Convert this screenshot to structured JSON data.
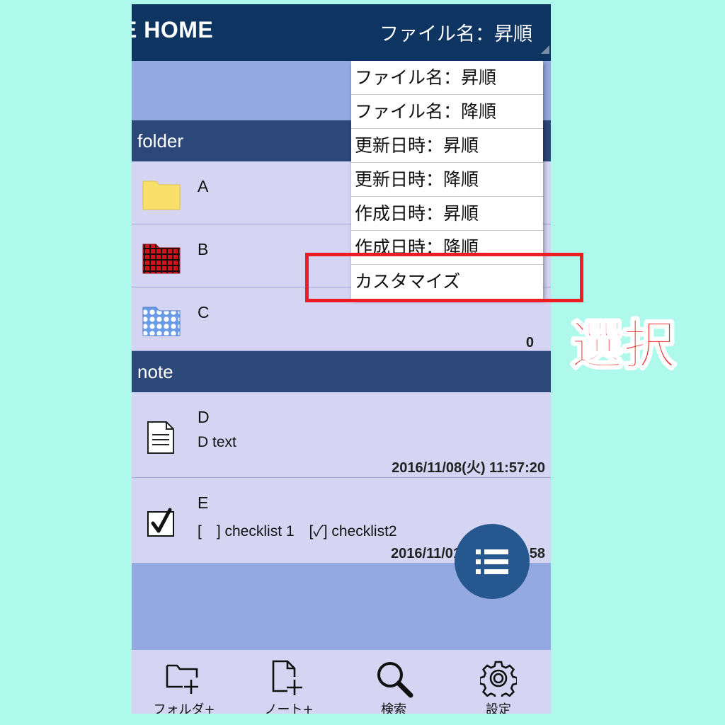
{
  "header": {
    "title": "E HOME",
    "sort_label": "ファイル名：昇順"
  },
  "folder_section": {
    "label": "folder",
    "items": [
      {
        "name": "A",
        "icon": "yellow-folder-icon"
      },
      {
        "name": "B",
        "icon": "red-plaid-folder-icon"
      },
      {
        "name": "C",
        "icon": "blue-polka-dot-folder-icon",
        "count": "0"
      }
    ]
  },
  "note_section": {
    "label": "note",
    "items": [
      {
        "name": "D",
        "preview": "D text",
        "date": "2016/11/08(火) 11:57:20",
        "icon": "document-icon"
      },
      {
        "name": "E",
        "preview": "[　] checklist 1　[✓] checklist2",
        "date": "2016/11/01(火) 10:39:58",
        "icon": "checkbox-icon"
      }
    ]
  },
  "sort_menu": {
    "items": [
      "ファイル名：昇順",
      "ファイル名：降順",
      "更新日時：昇順",
      "更新日時：降順",
      "作成日時：昇順",
      "作成日時：降順",
      "カスタマイズ"
    ]
  },
  "annotation": {
    "label": "選択",
    "color": "#ee1d23"
  },
  "bottom_nav": {
    "items": [
      {
        "label": "フォルダ+",
        "icon": "add-folder-icon"
      },
      {
        "label": "ノート+",
        "icon": "add-note-icon"
      },
      {
        "label": "検索",
        "icon": "search-icon"
      },
      {
        "label": "設定",
        "icon": "gear-icon"
      }
    ]
  },
  "colors": {
    "header": "#0e3462",
    "section_header": "#2b4878",
    "row_bg": "#d5d5f3",
    "list_bg": "#94a9e0",
    "fab": "#27578f",
    "page_bg": "#aef8ec"
  }
}
